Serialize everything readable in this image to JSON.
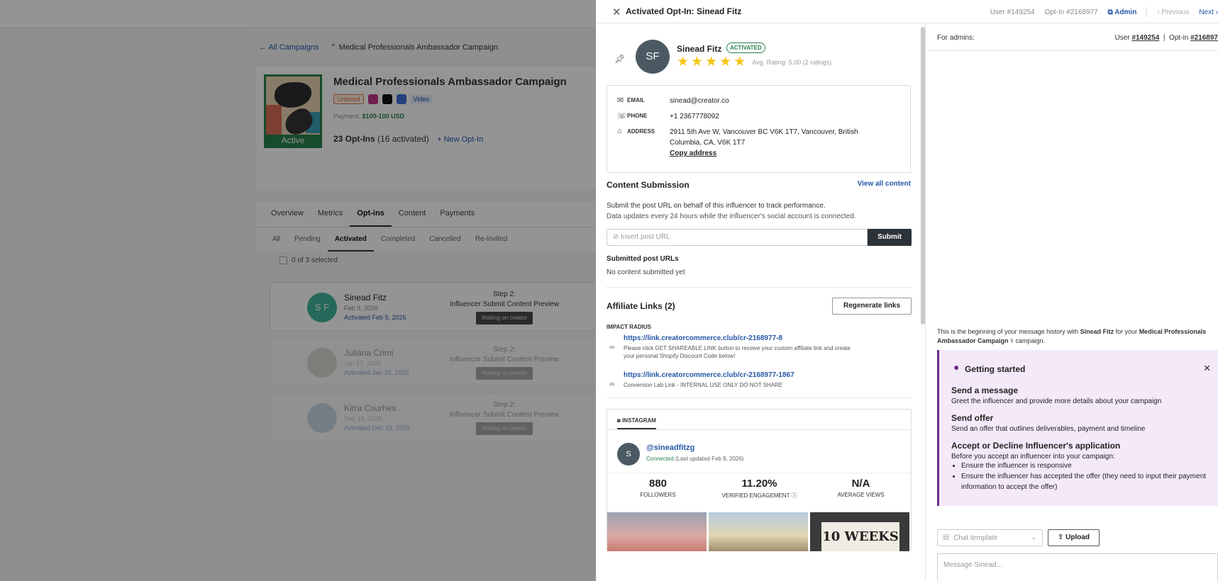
{
  "background": {
    "crumbs": {
      "back": "All Campaigns",
      "current": "Medical Professionals Ambassador Campaign"
    },
    "campaign": {
      "title": "Medical Professionals Ambassador Campaign",
      "status": "Active",
      "unlisted": "Unlisted",
      "video": "Video",
      "payment_label": "Payment:",
      "payment_value": "$100-100 USD",
      "optins": "23 Opt-Ins",
      "activated": "(16 activated)",
      "new_optin": "New Opt-In"
    },
    "tabs": [
      "Overview",
      "Metrics",
      "Opt-ins",
      "Content",
      "Payments"
    ],
    "subtabs": [
      "All",
      "Pending",
      "Activated",
      "Completed",
      "Cancelled",
      "Re-Invited"
    ],
    "selected_count": "0 of 3 selected",
    "rows": [
      {
        "initials": "S F",
        "name": "Sinead Fitz",
        "date": "Feb 9, 2026",
        "activated": "Activated Feb 9, 2026",
        "step": "Step 2:",
        "step_name": "Influencer Submit Content Preview",
        "status": "Waiting on creator"
      },
      {
        "initials": "",
        "name": "Juliana Crimi",
        "date": "Jan 27, 2026",
        "activated": "Activated Jan 28, 2026",
        "step": "Step 2:",
        "step_name": "Influencer Submit Content Preview",
        "status": "Waiting on creator"
      },
      {
        "initials": "",
        "name": "Kirra Csurhes",
        "date": "Dec 18, 2025",
        "activated": "Activated Dec 19, 2025",
        "step": "Step 2:",
        "step_name": "Influencer Submit Content Preview",
        "status": "Waiting on creator"
      }
    ]
  },
  "panel": {
    "title": "Activated Opt-In: Sinead Fitz",
    "user_id": "User #149254",
    "optin_id": "Opt-In #2168977",
    "admin": "Admin",
    "previous": "Previous",
    "next": "Next",
    "influencer": {
      "initials": "SF",
      "name": "Sinead Fitz",
      "badge": "ACTIVATED",
      "rating": "Avg. Rating: 5.00 (2 ratings)",
      "stars": 5
    },
    "contact": {
      "email_label": "EMAIL",
      "email": "sinead@creator.co",
      "phone_label": "PHONE",
      "phone": "+1 2367778092",
      "address_label": "ADDRESS",
      "address": "2911 5th Ave W, Vancouver BC V6K 1T7, Vancouver, British Columbia, CA, V6K 1T7",
      "copy": "Copy address"
    },
    "content": {
      "title": "Content Submission",
      "view_all": "View all content",
      "desc1": "Submit the post URL on behalf of this influencer to track performance.",
      "desc2": "Data updates every 24 hours while the influencer's social account is connected.",
      "placeholder": "Insert post URL",
      "submit": "Submit",
      "submitted_title": "Submitted post URLs",
      "none": "No content submitted yet"
    },
    "affiliate": {
      "title": "Affiliate Links (2)",
      "regen": "Regenerate links",
      "brand": "IMPACT RADIUS",
      "links": [
        {
          "url": "https://link.creatorcommerce.club/cr-2168977-8",
          "note": "Please click GET SHAREABLE LINK button to receive your custom affiliate link and create your personal Shopify Discount Code below!"
        },
        {
          "url": "https://link.creatorcommerce.club/cr-2168977-1867",
          "note": "Conversion Lab Link - INTERNAL USE ONLY DO NOT SHARE"
        }
      ]
    },
    "instagram": {
      "tab": "INSTAGRAM",
      "initial": "S",
      "handle": "@sineadfitzg",
      "connected": "Connected",
      "updated": "(Last updated Feb 8, 2026)",
      "followers": "880",
      "followers_label": "FOLLOWERS",
      "engagement": "11.20%",
      "engagement_label": "VERIFIED ENGAGEMENT",
      "views": "N/A",
      "views_label": "AVERAGE VIEWS",
      "photo3_text": "10 WEEKS"
    },
    "chat": {
      "for_admins": "For admins:",
      "user_label": "User",
      "user_link": "#149254",
      "optin_label": "Opt-in",
      "optin_link": "#216897",
      "history_pre": "This is the beginning of your message history with",
      "history_name": "Sinead Fitz",
      "history_mid": "for your",
      "history_campaign": "Medical Professionals Ambassador Campaign",
      "history_post": "campaign.",
      "gs_title": "Getting started",
      "gs_items": [
        {
          "h": "Send a message",
          "s": "Greet the influencer and provide more details about your campaign"
        },
        {
          "h": "Send offer",
          "s": "Send an offer that outlines deliverables, payment and timeline"
        },
        {
          "h": "Accept or Decline Influencer's application",
          "s": "Before you accept an influencer into your campaign:"
        }
      ],
      "gs_bullets": [
        "Ensure the influencer is responsive",
        "Ensure the influencer has accepted the offer (they need to input their payment information to accept the offer)"
      ],
      "template": "Chat template",
      "upload": "Upload",
      "message_placeholder": "Message Sinead..."
    }
  }
}
